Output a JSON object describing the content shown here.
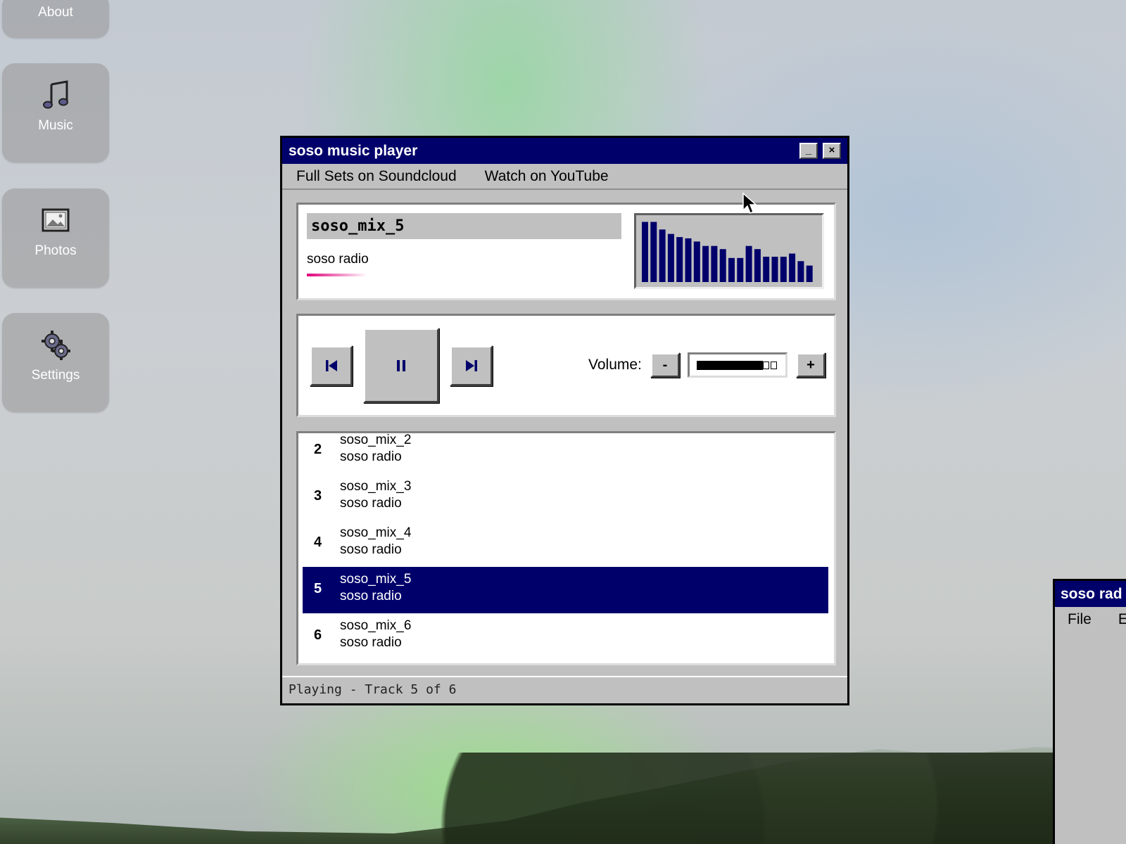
{
  "desktop": {
    "icons": [
      {
        "id": "about",
        "label": "About"
      },
      {
        "id": "music",
        "label": "Music",
        "icon": "music-note-icon"
      },
      {
        "id": "photos",
        "label": "Photos",
        "icon": "photo-icon"
      },
      {
        "id": "settings",
        "label": "Settings",
        "icon": "gear-icon"
      }
    ]
  },
  "player": {
    "title": "soso music player",
    "menu": [
      "Full Sets on Soundcloud",
      "Watch on YouTube"
    ],
    "now_playing": {
      "title": "soso_mix_5",
      "artist": "soso radio",
      "progress": 0.19,
      "visualizer_levels": [
        0.95,
        0.95,
        0.83,
        0.76,
        0.71,
        0.69,
        0.64,
        0.57,
        0.57,
        0.52,
        0.38,
        0.38,
        0.57,
        0.52,
        0.4,
        0.4,
        0.4,
        0.45,
        0.33,
        0.26
      ]
    },
    "controls": {
      "prev_icon": "skip-previous-icon",
      "pause_icon": "pause-icon",
      "next_icon": "skip-next-icon",
      "volume_label": "Volume:",
      "volume_minus": "-",
      "volume_plus": "+",
      "volume_level": 0.8
    },
    "playlist": [
      {
        "num": "2",
        "title": "soso_mix_2",
        "artist": "soso radio"
      },
      {
        "num": "3",
        "title": "soso_mix_3",
        "artist": "soso radio"
      },
      {
        "num": "4",
        "title": "soso_mix_4",
        "artist": "soso radio"
      },
      {
        "num": "5",
        "title": "soso_mix_5",
        "artist": "soso radio",
        "active": true
      },
      {
        "num": "6",
        "title": "soso_mix_6",
        "artist": "soso radio"
      }
    ],
    "status": "Playing - Track 5 of 6",
    "colors": {
      "titlebar": "#00006b",
      "accent": "#e0007a",
      "window": "#c0c0c0"
    }
  },
  "second_window": {
    "title": "soso rad",
    "menu": [
      "File",
      "E"
    ]
  }
}
